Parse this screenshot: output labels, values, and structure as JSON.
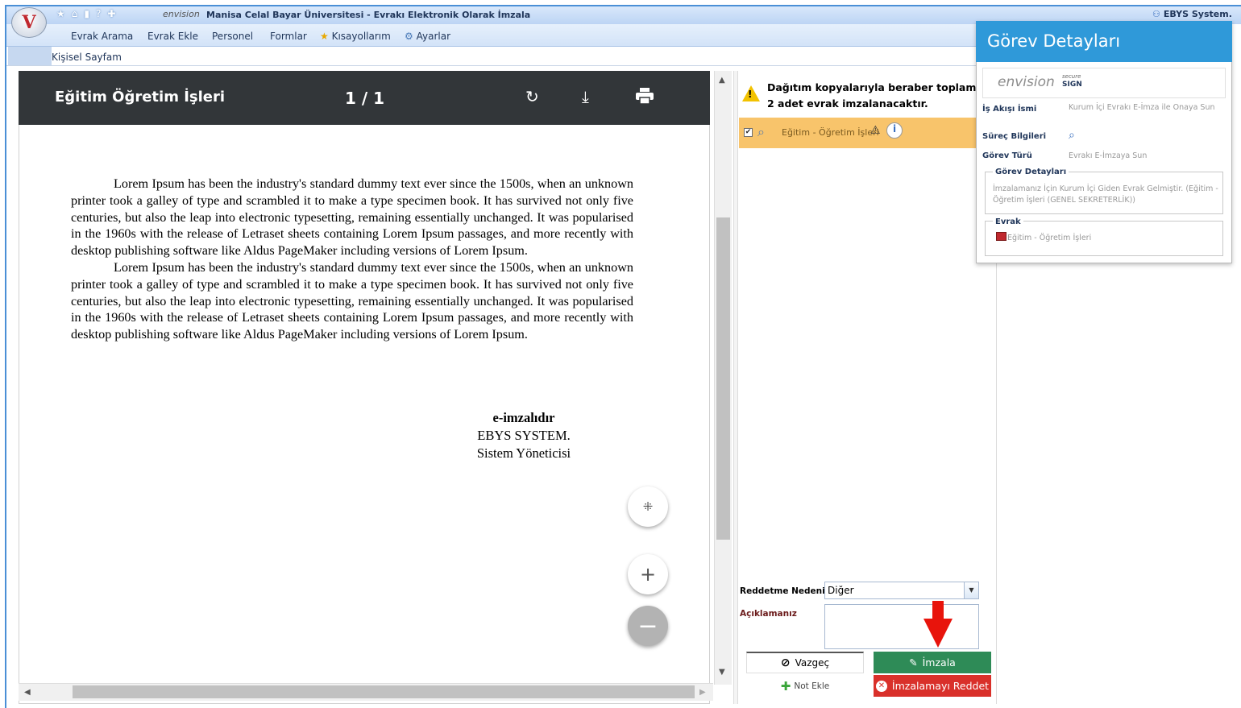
{
  "window": {
    "title_brand": "envision",
    "title": "Manisa Celal Bayar Üniversitesi - Evrakı Elektronik Olarak İmzala",
    "user": "EBYS System."
  },
  "menu": {
    "items": [
      "Evrak Arama",
      "Evrak Ekle",
      "Personel",
      "Formlar",
      "Kısayollarım",
      "Ayarlar"
    ]
  },
  "tabs": {
    "active": "Kişisel Sayfam"
  },
  "viewer": {
    "doc_title": "Eğitim Öğretim İşleri",
    "page_current": "1",
    "page_total": "1",
    "page_display": "1 / 1",
    "paragraphs": [
      "Lorem Ipsum has been the industry's standard dummy text ever since the 1500s, when an unknown printer took a galley of type and scrambled it to make a type specimen book. It has survived not only five centuries, but also the leap into electronic typesetting, remaining essentially unchanged. It was popularised in the 1960s with the release of Letraset sheets containing Lorem Ipsum passages, and more recently with desktop publishing software like Aldus PageMaker including versions of Lorem Ipsum.",
      "Lorem Ipsum has been the industry's standard dummy text ever since the 1500s, when an unknown printer took a galley of type and scrambled it to make a type specimen book. It has survived not only five centuries, but also the leap into electronic typesetting, remaining essentially unchanged. It was popularised in the 1960s with the release of Letraset sheets containing Lorem Ipsum passages, and more recently with desktop publishing software like Aldus PageMaker including versions of Lorem Ipsum."
    ],
    "signature": {
      "status": "e-imzalıdır",
      "name": "EBYS SYSTEM.",
      "role": "Sistem Yöneticisi"
    },
    "icons": [
      "rotate-icon",
      "download-icon",
      "print-icon",
      "fit-page-icon",
      "zoom-in-icon",
      "zoom-out-icon"
    ]
  },
  "signing_panel": {
    "warning": "Dağıtım kopyalarıyla beraber toplam 2 adet evrak imzalanacaktır.",
    "doc_item": "Eğitim - Öğretim İşleri",
    "reason_label": "Reddetme Nedeni",
    "reason_value": "Diğer",
    "desc_label": "Açıklamanız",
    "cancel_label": "Vazgeç",
    "sign_label": "İmzala",
    "note_label": "Not Ekle",
    "reject_label": "İmzalamayı Reddet"
  },
  "task_details": {
    "title": "Görev Detayları",
    "brand_envision": "envision",
    "brand_secure_top": "secure",
    "brand_secure_bottom": "SIGN",
    "flow_label": "İş Akışı İsmi",
    "flow_value": "Kurum İçi Evrakı E-İmza ile Onaya Sun",
    "process_label": "Süreç Bilgileri",
    "type_label": "Görev Türü",
    "type_value": "Evrakı E-İmzaya Sun",
    "detail_legend": "Görev Detayları",
    "detail_text": "İmzalamanız İçin Kurum İçi Giden Evrak Gelmiştir. (Eğitim - Öğretim İşleri (GENEL SEKRETERLİK))",
    "doc_legend": "Evrak",
    "doc_value": "Eğitim - Öğretim İşleri"
  },
  "colors": {
    "sign_button": "#2e8b57",
    "reject_button": "#d9302a",
    "task_header": "#2f99d9",
    "viewer_toolbar": "#323639",
    "selected_row": "#f8c46b",
    "annotation_arrow": "#e8140c"
  }
}
